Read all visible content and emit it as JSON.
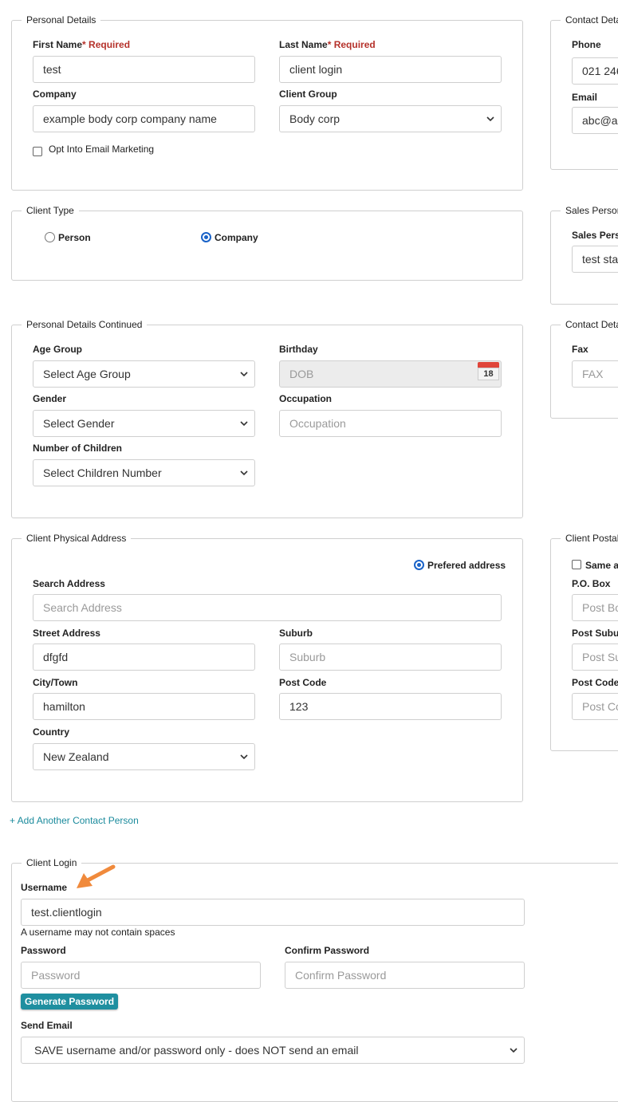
{
  "personal_details": {
    "legend": "Personal Details",
    "first_name": {
      "label": "First Name",
      "required": "* Required",
      "value": "test"
    },
    "last_name": {
      "label": "Last Name",
      "required": "* Required",
      "value": "client login"
    },
    "company": {
      "label": "Company",
      "value": "example body corp company name"
    },
    "client_group": {
      "label": "Client Group",
      "value": "Body corp"
    },
    "email_marketing": "Opt Into Email Marketing"
  },
  "contact_details": {
    "legend": "Contact Deta",
    "phone": {
      "label": "Phone",
      "value": "021 246"
    },
    "email": {
      "label": "Email",
      "value": "abc@ab"
    }
  },
  "client_type": {
    "legend": "Client Type",
    "person": "Person",
    "company": "Company"
  },
  "sales_person": {
    "legend": "Sales Person",
    "label": "Sales Pers",
    "value": "test sta"
  },
  "personal_details_continued": {
    "legend": "Personal Details Continued",
    "age_group": {
      "label": "Age Group",
      "value": "Select Age Group"
    },
    "birthday": {
      "label": "Birthday",
      "placeholder": "DOB",
      "calendar_day": "18"
    },
    "gender": {
      "label": "Gender",
      "value": "Select Gender"
    },
    "occupation": {
      "label": "Occupation",
      "placeholder": "Occupation"
    },
    "children": {
      "label": "Number of Children",
      "value": "Select Children Number"
    }
  },
  "contact_details_2": {
    "legend": "Contact Deta",
    "fax": {
      "label": "Fax",
      "placeholder": "FAX"
    }
  },
  "physical_address": {
    "legend": "Client Physical Address",
    "preferred": "Prefered address",
    "search": {
      "label": "Search Address",
      "placeholder": "Search Address"
    },
    "street": {
      "label": "Street Address",
      "value": "dfgfd"
    },
    "suburb": {
      "label": "Suburb",
      "placeholder": "Suburb"
    },
    "city": {
      "label": "City/Town",
      "value": "hamilton"
    },
    "post_code": {
      "label": "Post Code",
      "value": "123"
    },
    "country": {
      "label": "Country",
      "value": "New Zealand"
    }
  },
  "postal_address": {
    "legend": "Client Postal",
    "same_as": "Same a",
    "po_box": {
      "label": "P.O. Box",
      "placeholder": "Post Bo"
    },
    "post_suburb": {
      "label": "Post Subur",
      "placeholder": "Post Su"
    },
    "post_code": {
      "label": "Post Code",
      "placeholder": "Post Co"
    }
  },
  "add_contact_link": "+ Add Another Contact Person",
  "client_login": {
    "legend": "Client Login",
    "username": {
      "label": "Username",
      "value": "test.clientlogin",
      "hint": "A username may not contain spaces"
    },
    "password": {
      "label": "Password",
      "placeholder": "Password"
    },
    "confirm_password": {
      "label": "Confirm Password",
      "placeholder": "Confirm Password"
    },
    "generate_button": "Generate Password",
    "send_email": {
      "label": "Send Email",
      "value": "SAVE username and/or password only - does NOT send an email"
    }
  },
  "colors": {
    "required": "#b5312a",
    "link": "#1a8a9c",
    "button": "#1f8fa0",
    "radio": "#1a63c8",
    "arrow": "#f08a3c"
  }
}
